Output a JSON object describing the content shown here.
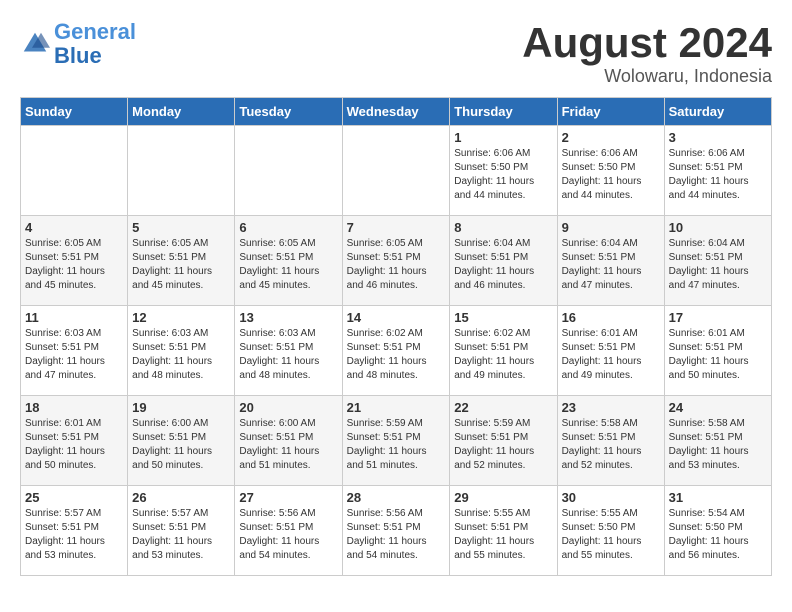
{
  "header": {
    "logo_line1": "General",
    "logo_line2": "Blue",
    "month_title": "August 2024",
    "location": "Wolowaru, Indonesia"
  },
  "weekdays": [
    "Sunday",
    "Monday",
    "Tuesday",
    "Wednesday",
    "Thursday",
    "Friday",
    "Saturday"
  ],
  "weeks": [
    [
      {
        "day": "",
        "sunrise": "",
        "sunset": "",
        "daylight": ""
      },
      {
        "day": "",
        "sunrise": "",
        "sunset": "",
        "daylight": ""
      },
      {
        "day": "",
        "sunrise": "",
        "sunset": "",
        "daylight": ""
      },
      {
        "day": "",
        "sunrise": "",
        "sunset": "",
        "daylight": ""
      },
      {
        "day": "1",
        "sunrise": "Sunrise: 6:06 AM",
        "sunset": "Sunset: 5:50 PM",
        "daylight": "Daylight: 11 hours and 44 minutes."
      },
      {
        "day": "2",
        "sunrise": "Sunrise: 6:06 AM",
        "sunset": "Sunset: 5:50 PM",
        "daylight": "Daylight: 11 hours and 44 minutes."
      },
      {
        "day": "3",
        "sunrise": "Sunrise: 6:06 AM",
        "sunset": "Sunset: 5:51 PM",
        "daylight": "Daylight: 11 hours and 44 minutes."
      }
    ],
    [
      {
        "day": "4",
        "sunrise": "Sunrise: 6:05 AM",
        "sunset": "Sunset: 5:51 PM",
        "daylight": "Daylight: 11 hours and 45 minutes."
      },
      {
        "day": "5",
        "sunrise": "Sunrise: 6:05 AM",
        "sunset": "Sunset: 5:51 PM",
        "daylight": "Daylight: 11 hours and 45 minutes."
      },
      {
        "day": "6",
        "sunrise": "Sunrise: 6:05 AM",
        "sunset": "Sunset: 5:51 PM",
        "daylight": "Daylight: 11 hours and 45 minutes."
      },
      {
        "day": "7",
        "sunrise": "Sunrise: 6:05 AM",
        "sunset": "Sunset: 5:51 PM",
        "daylight": "Daylight: 11 hours and 46 minutes."
      },
      {
        "day": "8",
        "sunrise": "Sunrise: 6:04 AM",
        "sunset": "Sunset: 5:51 PM",
        "daylight": "Daylight: 11 hours and 46 minutes."
      },
      {
        "day": "9",
        "sunrise": "Sunrise: 6:04 AM",
        "sunset": "Sunset: 5:51 PM",
        "daylight": "Daylight: 11 hours and 47 minutes."
      },
      {
        "day": "10",
        "sunrise": "Sunrise: 6:04 AM",
        "sunset": "Sunset: 5:51 PM",
        "daylight": "Daylight: 11 hours and 47 minutes."
      }
    ],
    [
      {
        "day": "11",
        "sunrise": "Sunrise: 6:03 AM",
        "sunset": "Sunset: 5:51 PM",
        "daylight": "Daylight: 11 hours and 47 minutes."
      },
      {
        "day": "12",
        "sunrise": "Sunrise: 6:03 AM",
        "sunset": "Sunset: 5:51 PM",
        "daylight": "Daylight: 11 hours and 48 minutes."
      },
      {
        "day": "13",
        "sunrise": "Sunrise: 6:03 AM",
        "sunset": "Sunset: 5:51 PM",
        "daylight": "Daylight: 11 hours and 48 minutes."
      },
      {
        "day": "14",
        "sunrise": "Sunrise: 6:02 AM",
        "sunset": "Sunset: 5:51 PM",
        "daylight": "Daylight: 11 hours and 48 minutes."
      },
      {
        "day": "15",
        "sunrise": "Sunrise: 6:02 AM",
        "sunset": "Sunset: 5:51 PM",
        "daylight": "Daylight: 11 hours and 49 minutes."
      },
      {
        "day": "16",
        "sunrise": "Sunrise: 6:01 AM",
        "sunset": "Sunset: 5:51 PM",
        "daylight": "Daylight: 11 hours and 49 minutes."
      },
      {
        "day": "17",
        "sunrise": "Sunrise: 6:01 AM",
        "sunset": "Sunset: 5:51 PM",
        "daylight": "Daylight: 11 hours and 50 minutes."
      }
    ],
    [
      {
        "day": "18",
        "sunrise": "Sunrise: 6:01 AM",
        "sunset": "Sunset: 5:51 PM",
        "daylight": "Daylight: 11 hours and 50 minutes."
      },
      {
        "day": "19",
        "sunrise": "Sunrise: 6:00 AM",
        "sunset": "Sunset: 5:51 PM",
        "daylight": "Daylight: 11 hours and 50 minutes."
      },
      {
        "day": "20",
        "sunrise": "Sunrise: 6:00 AM",
        "sunset": "Sunset: 5:51 PM",
        "daylight": "Daylight: 11 hours and 51 minutes."
      },
      {
        "day": "21",
        "sunrise": "Sunrise: 5:59 AM",
        "sunset": "Sunset: 5:51 PM",
        "daylight": "Daylight: 11 hours and 51 minutes."
      },
      {
        "day": "22",
        "sunrise": "Sunrise: 5:59 AM",
        "sunset": "Sunset: 5:51 PM",
        "daylight": "Daylight: 11 hours and 52 minutes."
      },
      {
        "day": "23",
        "sunrise": "Sunrise: 5:58 AM",
        "sunset": "Sunset: 5:51 PM",
        "daylight": "Daylight: 11 hours and 52 minutes."
      },
      {
        "day": "24",
        "sunrise": "Sunrise: 5:58 AM",
        "sunset": "Sunset: 5:51 PM",
        "daylight": "Daylight: 11 hours and 53 minutes."
      }
    ],
    [
      {
        "day": "25",
        "sunrise": "Sunrise: 5:57 AM",
        "sunset": "Sunset: 5:51 PM",
        "daylight": "Daylight: 11 hours and 53 minutes."
      },
      {
        "day": "26",
        "sunrise": "Sunrise: 5:57 AM",
        "sunset": "Sunset: 5:51 PM",
        "daylight": "Daylight: 11 hours and 53 minutes."
      },
      {
        "day": "27",
        "sunrise": "Sunrise: 5:56 AM",
        "sunset": "Sunset: 5:51 PM",
        "daylight": "Daylight: 11 hours and 54 minutes."
      },
      {
        "day": "28",
        "sunrise": "Sunrise: 5:56 AM",
        "sunset": "Sunset: 5:51 PM",
        "daylight": "Daylight: 11 hours and 54 minutes."
      },
      {
        "day": "29",
        "sunrise": "Sunrise: 5:55 AM",
        "sunset": "Sunset: 5:51 PM",
        "daylight": "Daylight: 11 hours and 55 minutes."
      },
      {
        "day": "30",
        "sunrise": "Sunrise: 5:55 AM",
        "sunset": "Sunset: 5:50 PM",
        "daylight": "Daylight: 11 hours and 55 minutes."
      },
      {
        "day": "31",
        "sunrise": "Sunrise: 5:54 AM",
        "sunset": "Sunset: 5:50 PM",
        "daylight": "Daylight: 11 hours and 56 minutes."
      }
    ]
  ]
}
